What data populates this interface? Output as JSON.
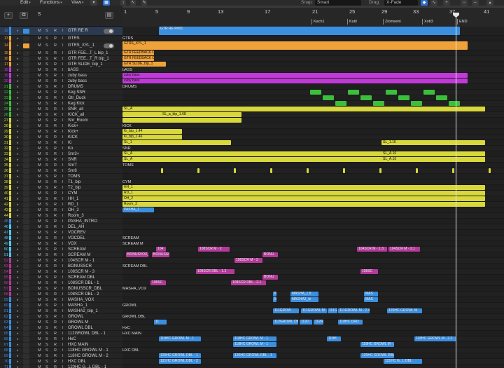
{
  "menubar": {
    "edit": "Edit",
    "functions": "Functions",
    "view": "View",
    "snap_label": "Snap:",
    "snap_value": "Smart",
    "drag_label": "Drag:",
    "drag_value": "X-Fade"
  },
  "ruler": {
    "bars": [
      "1",
      "5",
      "9",
      "13",
      "17",
      "21",
      "25",
      "29",
      "33",
      "37",
      "41"
    ],
    "markers": [
      "Kach1",
      "Kutil",
      "Zlomeeni",
      "Xotl3",
      "END"
    ]
  },
  "colors": {
    "blue": "#3a8fe0",
    "orange": "#f0a23a",
    "purple": "#c03ad8",
    "green": "#3bbf3b",
    "yellow": "#d8d73c",
    "lightblue": "#55c8f0",
    "magenta": "#b43a9a",
    "teal": "#2a9ea0"
  },
  "tracks": [
    {
      "n": "12",
      "name": "GTR RE R",
      "color": "#3a8fe0",
      "btns": true,
      "toggle": true
    },
    {
      "n": "13",
      "name": "GTRS",
      "color": "#f0a23a"
    },
    {
      "n": "14",
      "name": "GTRS_XYL_1",
      "color": "#f0a23a",
      "toggle": true
    },
    {
      "n": "15",
      "name": "GTR FEE...T_L bip_1",
      "color": "#f0a23a"
    },
    {
      "n": "16",
      "name": "GTR FEE...T_R bip_1",
      "color": "#f0a23a"
    },
    {
      "n": "17",
      "name": "GTR SLIDE_bip_1",
      "color": "#f0a23a"
    },
    {
      "n": "18",
      "name": "bASS",
      "color": "#c03ad8"
    },
    {
      "n": "19",
      "name": "zuby bass",
      "color": "#c03ad8"
    },
    {
      "n": "20",
      "name": "zuby bass",
      "color": "#c03ad8"
    },
    {
      "n": "21",
      "name": "DRUMS",
      "color": "#3bbf3b"
    },
    {
      "n": "22",
      "name": "Keg SNR",
      "color": "#3bbf3b"
    },
    {
      "n": "23",
      "name": "Gtr_Duck",
      "color": "#3bbf3b"
    },
    {
      "n": "24",
      "name": "Keg Kick",
      "color": "#3bbf3b"
    },
    {
      "n": "25",
      "name": "SNR_all",
      "color": "#3bbf3b"
    },
    {
      "n": "26",
      "name": "KICK_all",
      "color": "#3bbf3b"
    },
    {
      "n": "27",
      "name": "Snr_Room",
      "color": "#d8d73c"
    },
    {
      "n": "28",
      "name": "Kick+",
      "color": "#d8d73c"
    },
    {
      "n": "29",
      "name": "Kick+",
      "color": "#d8d73c"
    },
    {
      "n": "30",
      "name": "KICK",
      "color": "#d8d73c"
    },
    {
      "n": "31",
      "name": "Ki",
      "color": "#d8d73c"
    },
    {
      "n": "32",
      "name": "Ko",
      "color": "#d8d73c"
    },
    {
      "n": "33",
      "name": "Snr3+",
      "color": "#d8d73c"
    },
    {
      "n": "34",
      "name": "SNR",
      "color": "#d8d73c"
    },
    {
      "n": "35",
      "name": "SnrT",
      "color": "#d8d73c"
    },
    {
      "n": "36",
      "name": "Snr8",
      "color": "#d8d73c"
    },
    {
      "n": "37",
      "name": "TOMS",
      "color": "#d8d73c"
    },
    {
      "n": "38",
      "name": "T1_bip",
      "color": "#d8d73c"
    },
    {
      "n": "39",
      "name": "T2_bip",
      "color": "#d8d73c"
    },
    {
      "n": "40",
      "name": "CYM",
      "color": "#d8d73c"
    },
    {
      "n": "41",
      "name": "HH_1",
      "color": "#d8d73c"
    },
    {
      "n": "42",
      "name": "RD_1",
      "color": "#d8d73c"
    },
    {
      "n": "43",
      "name": "OH_2",
      "color": "#d8d73c"
    },
    {
      "n": "44",
      "name": "Room_3",
      "color": "#d8d73c"
    },
    {
      "n": "45",
      "name": "PASHA_INTRO",
      "color": "#3a8fe0"
    },
    {
      "n": "46",
      "name": "DEL_AH",
      "color": "#55c8f0"
    },
    {
      "n": "47",
      "name": "VOCREV",
      "color": "#55c8f0"
    },
    {
      "n": "48",
      "name": "VOCDEL",
      "color": "#55c8f0"
    },
    {
      "n": "49",
      "name": "VOX",
      "color": "#55c8f0"
    },
    {
      "n": "50",
      "name": "SCREAM",
      "color": "#55c8f0"
    },
    {
      "n": "51",
      "name": "SCREAM M",
      "color": "#55c8f0"
    },
    {
      "n": "52",
      "name": "104SCR M - 1",
      "color": "#b43a9a"
    },
    {
      "n": "53",
      "name": "BONUSSCR",
      "color": "#b43a9a"
    },
    {
      "n": "54",
      "name": "108SCR M - 3",
      "color": "#b43a9a"
    },
    {
      "n": "55",
      "name": "SCREAM DBL",
      "color": "#b43a9a"
    },
    {
      "n": "56",
      "name": "108SCR DBL - 1",
      "color": "#b43a9a"
    },
    {
      "n": "57",
      "name": "BONUSSCR_DBL",
      "color": "#b43a9a"
    },
    {
      "n": "58",
      "name": "108SCR DBL - 2",
      "color": "#b43a9a"
    },
    {
      "n": "59",
      "name": "MASHA_VOX",
      "color": "#3a8fe0"
    },
    {
      "n": "60",
      "name": "MASHA_1",
      "color": "#3a8fe0"
    },
    {
      "n": "61",
      "name": "MASHA2_bip_1",
      "color": "#3a8fe0"
    },
    {
      "n": "62",
      "name": "GROWL",
      "color": "#3a8fe0"
    },
    {
      "n": "63",
      "name": "GROWL M",
      "color": "#3a8fe0"
    },
    {
      "n": "64",
      "name": "GROWL DBL",
      "color": "#3a8fe0"
    },
    {
      "n": "65",
      "name": "112GROWL DBL - 1",
      "color": "#3a8fe0"
    },
    {
      "n": "66",
      "name": "HxC",
      "color": "#3a8fe0"
    },
    {
      "n": "67",
      "name": "HXC MAIN",
      "color": "#3a8fe0"
    },
    {
      "n": "68",
      "name": "118HC GROWL M - 1",
      "color": "#3a8fe0"
    },
    {
      "n": "69",
      "name": "118HC GROWL M - 2",
      "color": "#3a8fe0"
    },
    {
      "n": "70",
      "name": "HXC DBL",
      "color": "#3a8fe0"
    },
    {
      "n": "71",
      "name": "120HC G...L DBL - 1",
      "color": "#3a8fe0"
    },
    {
      "n": "72",
      "name": "121HC GR...L DBL - 2",
      "color": "#3a8fe0"
    }
  ],
  "regions": {
    "gtr_re_r": "GTR RE R#01",
    "gtrs": "GTRS",
    "gtrs_xyl": "GTRS_XYL_1",
    "fee_l": "GTR FEEDBACK CUT L",
    "fee_r": "GTR FEEDBACK CUT R",
    "slide": "GTR SLIDE_bip_1",
    "bass": "bASS",
    "zuby1": "zuby bass",
    "zuby2": "zuby bass",
    "drums": "DRUMS",
    "snr_all": "SL_A",
    "snr_all2": "SL_a_bip_1.68",
    "kick": "KICK",
    "kick_r1": "Ki_bip_1.44",
    "kick_r2": "Ki_bip_1.46",
    "sl_k1": "SL_1",
    "sl_k2": "SL_1.16",
    "snr": "SNR",
    "snr_r1": "SL_A",
    "snr_r2": "SL_A",
    "snr_r3": "SL_A.16",
    "snr_r4": "SL_A.16",
    "toms": "TOMS",
    "cym": "CYM",
    "hh": "HH_1",
    "rd": "RD_1",
    "oh": "OH_2",
    "room": "Room_3",
    "pasha": "PASHA_1",
    "scream": "SCREAM",
    "scream_m": "SCREAM M",
    "s104": "104SCR M - 1.3",
    "s104b": "104SCR M - 2.1",
    "bonusvox": "BONUSVOX_",
    "bonusscr": "BONUSSCR",
    "s108m2": "108SCR M - 2",
    "s108m3": "108SCR M - 3",
    "bonu": "BONU",
    "s104a": "104",
    "scream_dbl": "SCREAM DBL",
    "s108dbl1": "108SCR DBL - 1.2",
    "s108sc": "108SC",
    "bonu2": "BONU",
    "s108sc2": "108SC",
    "s108dbl2": "108SCR DBL - 2.1",
    "masha_vox": "MASHA_VOX",
    "masha1": "MASHA_1.8",
    "masha2": "MASHA2_bi",
    "mas": "MAS",
    "mas2": "MAS",
    "m": "M",
    "m2": "M",
    "growl": "GROWL",
    "growl_m1": "111GROW",
    "growl_m2": "111GROWL M",
    "growl_m3": "111G",
    "growl_m4": "111GROWL M - 2.4",
    "growl_m5": "120HC GROWL M",
    "growl_dbl": "GROWL DBL",
    "g112": "112GROWL D",
    "g112b": "112GROWL DBL",
    "g112c": "112D",
    "g118": "118HC DRO",
    "g11": "11",
    "g110": "110",
    "g112r": "112R",
    "hxc": "HxC",
    "hxc_main": "HXC MAIN",
    "h118_1": "118HC GROWL M - 1",
    "h118_2": "118HC GROWL M - 1",
    "h118_3": "118HC GROWL M - 2.3",
    "h118_4": "118H",
    "h118_5": "118HC GROWL M - 2",
    "h118_6": "118HC GROWL M - 1",
    "hxc_dbl": "HXC DBL",
    "h120_1": "120HC GROWL DBL - 1",
    "h120_2": "120HC GROWL DBL - 1",
    "h120_3": "120HC GROWL DBL",
    "h121_1": "121HC GROWL DBL - 2",
    "h121_2": "121HC GROWL DBL",
    "h121_3": "121HC G...L DBL"
  }
}
